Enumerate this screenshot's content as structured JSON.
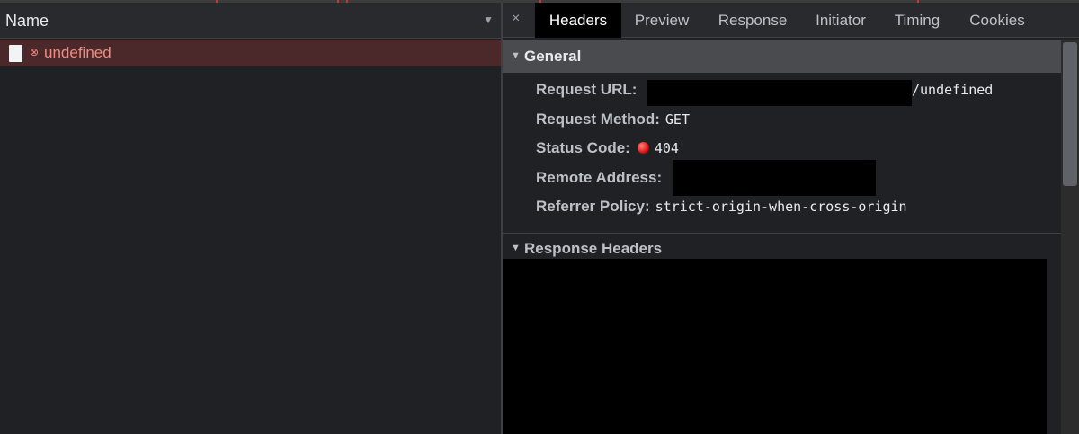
{
  "colors": {
    "background": "#202124",
    "error_row": "#4b2829",
    "error_text": "#f28b82",
    "active_tab": "#000000",
    "status_dot": "#d50000"
  },
  "request_list": {
    "column_header": "Name",
    "sort_icon": "triangle-down-icon",
    "rows": [
      {
        "name": "undefined",
        "icon": "document-icon",
        "status_icon": "error-icon"
      }
    ]
  },
  "tabs": {
    "close_glyph": "×",
    "items": [
      "Headers",
      "Preview",
      "Response",
      "Initiator",
      "Timing",
      "Cookies"
    ],
    "active": "Headers"
  },
  "general": {
    "title": "General",
    "request_url_label": "Request URL:",
    "request_url_value": "/undefined",
    "request_method_label": "Request Method:",
    "request_method_value": "GET",
    "status_code_label": "Status Code:",
    "status_code_value": "404",
    "remote_address_label": "Remote Address:",
    "referrer_policy_label": "Referrer Policy:",
    "referrer_policy_value": "strict-origin-when-cross-origin"
  },
  "response_headers": {
    "title": "Response Headers"
  }
}
